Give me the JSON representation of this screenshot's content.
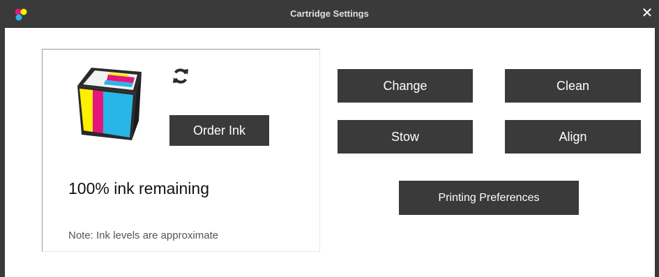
{
  "window": {
    "title": "Cartridge Settings",
    "close_glyph": "✕",
    "app_icon": "color-dots-icon"
  },
  "ink_panel": {
    "cartridge_icon": "ink-cartridge-icon",
    "refresh_icon": "refresh-icon",
    "order_ink_label": "Order Ink",
    "ink_remaining_text": "100% ink remaining",
    "ink_level_percent": 100,
    "note_text": "Note:  Ink levels are approximate"
  },
  "actions": {
    "change_label": "Change",
    "clean_label": "Clean",
    "stow_label": "Stow",
    "align_label": "Align",
    "printing_preferences_label": "Printing Preferences"
  },
  "colors": {
    "chrome": "#3a3a3a",
    "button_bg": "#3a3a3a",
    "button_text": "#ffffff",
    "cyan": "#29b6e6",
    "magenta": "#e4167b",
    "yellow": "#fff000"
  }
}
